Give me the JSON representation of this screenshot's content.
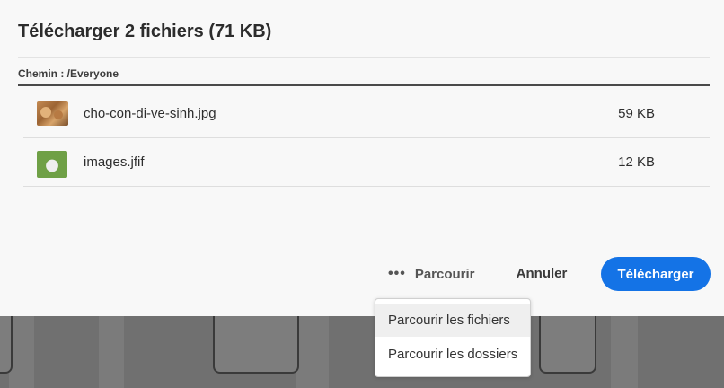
{
  "dialog": {
    "title": "Télécharger 2 fichiers (71 KB)",
    "path": "Chemin : /Everyone"
  },
  "files": [
    {
      "name": "cho-con-di-ve-sinh.jpg",
      "size": "59 KB",
      "thumbnail": "cats-photo"
    },
    {
      "name": "images.jfif",
      "size": "12 KB",
      "thumbnail": "dog-photo"
    }
  ],
  "actions": {
    "browse_label": "Parcourir",
    "more_icon": "ellipsis-icon",
    "cancel_label": "Annuler",
    "upload_label": "Télécharger"
  },
  "browse_menu": {
    "items": [
      "Parcourir les fichiers",
      "Parcourir les dossiers"
    ],
    "highlighted_index": 0
  },
  "colors": {
    "accent": "#1473e6",
    "dialog_bg": "#f8f8f8",
    "text": "#2c2c2c"
  }
}
